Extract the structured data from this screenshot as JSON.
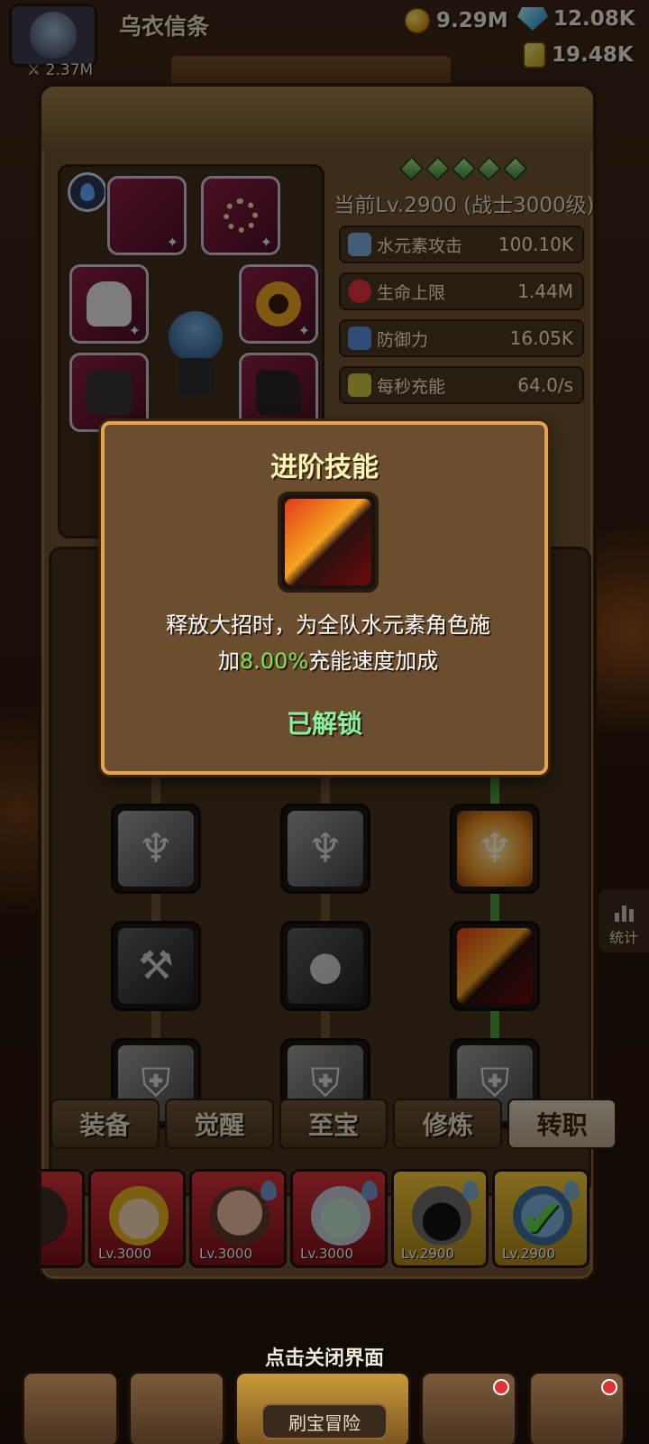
{
  "player": {
    "name": "乌衣信条",
    "power": "2.37M"
  },
  "resources": {
    "gold": "9.29M",
    "gems": "12.08K",
    "scrolls": "19.48K"
  },
  "character": {
    "level_text": "当前Lv.2900 (战士3000级)"
  },
  "stats": [
    {
      "label": "水元素攻击",
      "value": "100.10K",
      "icon": "water-attack-icon",
      "color": "#7aa9d8"
    },
    {
      "label": "生命上限",
      "value": "1.44M",
      "icon": "heart-icon",
      "color": "#e0303a"
    },
    {
      "label": "防御力",
      "value": "16.05K",
      "icon": "shield-icon",
      "color": "#5a8ad8"
    },
    {
      "label": "每秒充能",
      "value": "64.0/s",
      "icon": "feather-icon",
      "color": "#c9c040"
    }
  ],
  "tabs": [
    "装备",
    "觉醒",
    "至宝",
    "修炼",
    "转职"
  ],
  "active_tab": "转职",
  "heroes": [
    {
      "level": "",
      "frame": "red"
    },
    {
      "level": "Lv.3000",
      "frame": "red"
    },
    {
      "level": "Lv.3000",
      "frame": "red"
    },
    {
      "level": "Lv.3000",
      "frame": "red"
    },
    {
      "level": "Lv.2900",
      "frame": "yellow"
    },
    {
      "level": "Lv.2900",
      "frame": "yellow",
      "selected": true
    }
  ],
  "side": {
    "stats_label": "统计"
  },
  "modal": {
    "title": "进阶技能",
    "desc_line1": "释放大招时，为全队水元素角色施",
    "desc_prefix": "加",
    "desc_highlight": "8.00%",
    "desc_suffix": "充能速度加成",
    "status": "已解锁"
  },
  "close_hint": "点击关闭界面",
  "bottom": {
    "treasure_label": "刷宝冒险"
  }
}
